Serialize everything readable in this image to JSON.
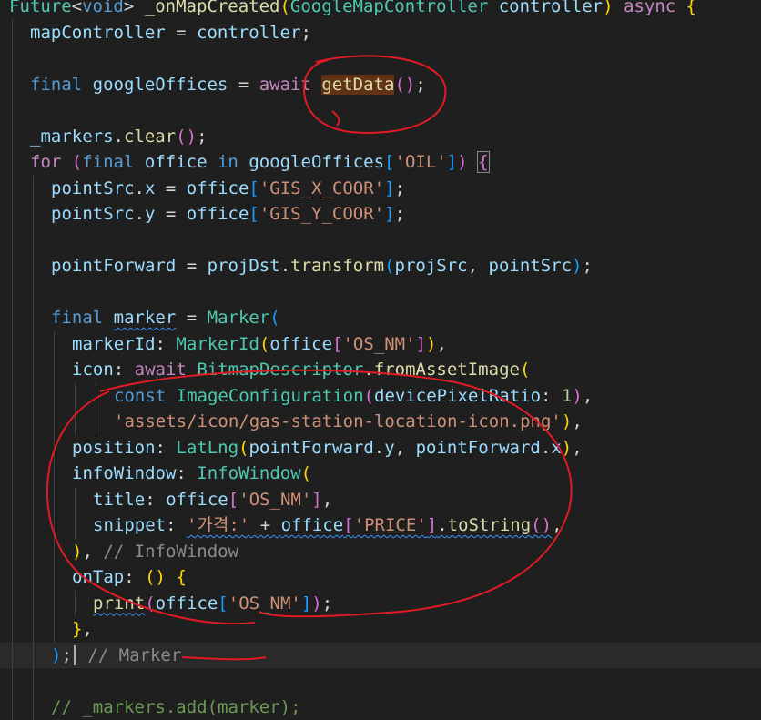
{
  "editor": {
    "current_line_index": 25,
    "lines": [
      {
        "indent": 0,
        "tokens": [
          [
            "type",
            "Future"
          ],
          [
            "plain",
            "<"
          ],
          [
            "kw",
            "void"
          ],
          [
            "plain",
            "> "
          ],
          [
            "fn",
            "_onMapCreated"
          ],
          [
            "b1",
            "("
          ],
          [
            "type",
            "GoogleMapController"
          ],
          [
            "plain",
            " "
          ],
          [
            "var",
            "controller"
          ],
          [
            "b1",
            ")"
          ],
          [
            "plain",
            " "
          ],
          [
            "ctl",
            "async"
          ],
          [
            "plain",
            " "
          ],
          [
            "b1",
            "{"
          ]
        ]
      },
      {
        "indent": 1,
        "tokens": [
          [
            "var",
            "mapController"
          ],
          [
            "plain",
            " = "
          ],
          [
            "var",
            "controller"
          ],
          [
            "plain",
            ";"
          ]
        ]
      },
      {
        "indent": 1,
        "tokens": []
      },
      {
        "indent": 1,
        "tokens": [
          [
            "kw",
            "final"
          ],
          [
            "plain",
            " "
          ],
          [
            "var",
            "googleOffices"
          ],
          [
            "plain",
            " = "
          ],
          [
            "ctl",
            "await"
          ],
          [
            "plain",
            " "
          ],
          [
            "fnhl",
            "getData"
          ],
          [
            "b2",
            "()"
          ],
          [
            "plain",
            ";"
          ]
        ]
      },
      {
        "indent": 1,
        "tokens": []
      },
      {
        "indent": 1,
        "tokens": [
          [
            "var",
            "_markers"
          ],
          [
            "plain",
            "."
          ],
          [
            "fn",
            "clear"
          ],
          [
            "b2",
            "()"
          ],
          [
            "plain",
            ";"
          ]
        ]
      },
      {
        "indent": 1,
        "tokens": [
          [
            "ctl",
            "for"
          ],
          [
            "plain",
            " "
          ],
          [
            "b2",
            "("
          ],
          [
            "kw",
            "final"
          ],
          [
            "plain",
            " "
          ],
          [
            "var",
            "office"
          ],
          [
            "plain",
            " "
          ],
          [
            "kw",
            "in"
          ],
          [
            "plain",
            " "
          ],
          [
            "var",
            "googleOffices"
          ],
          [
            "b3",
            "["
          ],
          [
            "str",
            "'OIL'"
          ],
          [
            "b3",
            "]"
          ],
          [
            "b2",
            ")"
          ],
          [
            "plain",
            " "
          ],
          [
            "b2box",
            "{"
          ]
        ]
      },
      {
        "indent": 2,
        "tokens": [
          [
            "var",
            "pointSrc"
          ],
          [
            "plain",
            "."
          ],
          [
            "var",
            "x"
          ],
          [
            "plain",
            " = "
          ],
          [
            "var",
            "office"
          ],
          [
            "b3",
            "["
          ],
          [
            "str",
            "'GIS_X_COOR'"
          ],
          [
            "b3",
            "]"
          ],
          [
            "plain",
            ";"
          ]
        ]
      },
      {
        "indent": 2,
        "tokens": [
          [
            "var",
            "pointSrc"
          ],
          [
            "plain",
            "."
          ],
          [
            "var",
            "y"
          ],
          [
            "plain",
            " = "
          ],
          [
            "var",
            "office"
          ],
          [
            "b3",
            "["
          ],
          [
            "str",
            "'GIS_Y_COOR'"
          ],
          [
            "b3",
            "]"
          ],
          [
            "plain",
            ";"
          ]
        ]
      },
      {
        "indent": 2,
        "tokens": []
      },
      {
        "indent": 2,
        "tokens": [
          [
            "var",
            "pointForward"
          ],
          [
            "plain",
            " = "
          ],
          [
            "var",
            "projDst"
          ],
          [
            "plain",
            "."
          ],
          [
            "fn",
            "transform"
          ],
          [
            "b3",
            "("
          ],
          [
            "var",
            "projSrc"
          ],
          [
            "plain",
            ", "
          ],
          [
            "var",
            "pointSrc"
          ],
          [
            "b3",
            ")"
          ],
          [
            "plain",
            ";"
          ]
        ]
      },
      {
        "indent": 2,
        "tokens": []
      },
      {
        "indent": 2,
        "tokens": [
          [
            "kw",
            "final"
          ],
          [
            "plain",
            " "
          ],
          [
            "varsq",
            "marker"
          ],
          [
            "plain",
            " = "
          ],
          [
            "type",
            "Marker"
          ],
          [
            "b3",
            "("
          ]
        ]
      },
      {
        "indent": 3,
        "tokens": [
          [
            "var",
            "markerId"
          ],
          [
            "plain",
            ": "
          ],
          [
            "type",
            "MarkerId"
          ],
          [
            "b1",
            "("
          ],
          [
            "var",
            "office"
          ],
          [
            "b2",
            "["
          ],
          [
            "str",
            "'OS_NM'"
          ],
          [
            "b2",
            "]"
          ],
          [
            "b1",
            ")"
          ],
          [
            "plain",
            ","
          ]
        ]
      },
      {
        "indent": 3,
        "tokens": [
          [
            "var",
            "icon"
          ],
          [
            "plain",
            ": "
          ],
          [
            "ctl",
            "await"
          ],
          [
            "plain",
            " "
          ],
          [
            "type",
            "BitmapDescriptor"
          ],
          [
            "plain",
            "."
          ],
          [
            "fn",
            "fromAssetImage"
          ],
          [
            "b1",
            "("
          ]
        ]
      },
      {
        "indent": 5,
        "tokens": [
          [
            "kw",
            "const"
          ],
          [
            "plain",
            " "
          ],
          [
            "type",
            "ImageConfiguration"
          ],
          [
            "b2",
            "("
          ],
          [
            "var",
            "devicePixelRatio"
          ],
          [
            "plain",
            ": "
          ],
          [
            "num",
            "1"
          ],
          [
            "b2",
            ")"
          ],
          [
            "plain",
            ","
          ]
        ]
      },
      {
        "indent": 5,
        "tokens": [
          [
            "str",
            "'assets/icon/gas-station-location-icon.png'"
          ],
          [
            "b1",
            ")"
          ],
          [
            "plain",
            ","
          ]
        ]
      },
      {
        "indent": 3,
        "tokens": [
          [
            "var",
            "position"
          ],
          [
            "plain",
            ": "
          ],
          [
            "type",
            "LatLng"
          ],
          [
            "b1",
            "("
          ],
          [
            "var",
            "pointForward"
          ],
          [
            "plain",
            "."
          ],
          [
            "var",
            "y"
          ],
          [
            "plain",
            ", "
          ],
          [
            "var",
            "pointForward"
          ],
          [
            "plain",
            "."
          ],
          [
            "var",
            "x"
          ],
          [
            "b1",
            ")"
          ],
          [
            "plain",
            ","
          ]
        ]
      },
      {
        "indent": 3,
        "tokens": [
          [
            "var",
            "infoWindow"
          ],
          [
            "plain",
            ": "
          ],
          [
            "type",
            "InfoWindow"
          ],
          [
            "b1",
            "("
          ]
        ]
      },
      {
        "indent": 4,
        "tokens": [
          [
            "var",
            "title"
          ],
          [
            "plain",
            ": "
          ],
          [
            "var",
            "office"
          ],
          [
            "b2",
            "["
          ],
          [
            "str",
            "'OS_NM'"
          ],
          [
            "b2",
            "]"
          ],
          [
            "plain",
            ","
          ]
        ]
      },
      {
        "indent": 4,
        "tokens": [
          [
            "var",
            "snippet"
          ],
          [
            "plain",
            ": "
          ],
          [
            "strsq",
            "'가격:'"
          ],
          [
            "plainsq",
            " + "
          ],
          [
            "varsq",
            "office"
          ],
          [
            "b2sq",
            "["
          ],
          [
            "strsq",
            "'PRICE'"
          ],
          [
            "b2sq",
            "]"
          ],
          [
            "plainsq",
            "."
          ],
          [
            "fnsq",
            "toString"
          ],
          [
            "b2sq",
            "()"
          ],
          [
            "plain",
            ","
          ]
        ]
      },
      {
        "indent": 3,
        "tokens": [
          [
            "b1",
            ")"
          ],
          [
            "plain",
            ", "
          ],
          [
            "hint",
            "// InfoWindow"
          ]
        ]
      },
      {
        "indent": 3,
        "tokens": [
          [
            "var",
            "onTap"
          ],
          [
            "plain",
            ": "
          ],
          [
            "b1",
            "()"
          ],
          [
            "plain",
            " "
          ],
          [
            "b1",
            "{"
          ]
        ]
      },
      {
        "indent": 4,
        "tokens": [
          [
            "fnsq",
            "print"
          ],
          [
            "b2",
            "("
          ],
          [
            "var",
            "office"
          ],
          [
            "b3",
            "["
          ],
          [
            "str",
            "'OS_NM'"
          ],
          [
            "b3",
            "]"
          ],
          [
            "b2",
            ")"
          ],
          [
            "plain",
            ";"
          ]
        ]
      },
      {
        "indent": 3,
        "tokens": [
          [
            "b1",
            "}"
          ],
          [
            "plain",
            ","
          ]
        ]
      },
      {
        "indent": 2,
        "tokens": [
          [
            "b3",
            ")"
          ],
          [
            "plain",
            ";"
          ],
          [
            "caret",
            ""
          ],
          [
            "plain",
            " "
          ],
          [
            "hint",
            "// Marker"
          ]
        ]
      },
      {
        "indent": 2,
        "tokens": []
      },
      {
        "indent": 2,
        "tokens": [
          [
            "com",
            "// _markers.add(marker);"
          ]
        ]
      }
    ]
  },
  "colors": {
    "background": "#1f1f1f",
    "annotation": "#e01b24"
  }
}
